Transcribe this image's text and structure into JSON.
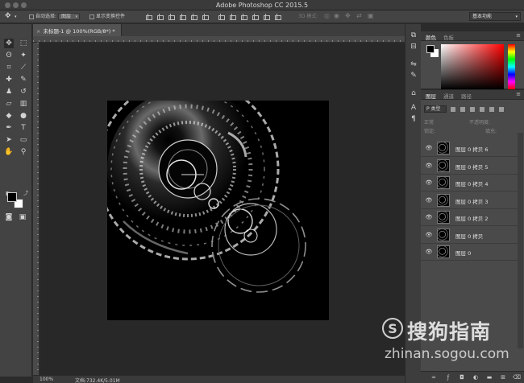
{
  "window": {
    "title": "Adobe Photoshop CC 2015.5"
  },
  "options_bar": {
    "auto_select_label": "自动选择:",
    "auto_select_value": "图层",
    "show_transform_label": "显示变换控件",
    "mode_3d_label": "3D 模式:",
    "workspace_value": "基本功能"
  },
  "document": {
    "tab_title": "未标题-1 @ 100%(RGB/8*) *",
    "zoom": "100%",
    "doc_info": "文档:732.4K/5.01M"
  },
  "toolbar": {
    "tools": [
      {
        "name": "move-tool",
        "glyph": "✥"
      },
      {
        "name": "marquee-tool",
        "glyph": "⬚"
      },
      {
        "name": "lasso-tool",
        "glyph": "ʘ"
      },
      {
        "name": "magic-wand-tool",
        "glyph": "✦"
      },
      {
        "name": "crop-tool",
        "glyph": "⌗"
      },
      {
        "name": "eyedropper-tool",
        "glyph": "⟋"
      },
      {
        "name": "healing-brush-tool",
        "glyph": "✚"
      },
      {
        "name": "brush-tool",
        "glyph": "✎"
      },
      {
        "name": "clone-stamp-tool",
        "glyph": "♟"
      },
      {
        "name": "history-brush-tool",
        "glyph": "↺"
      },
      {
        "name": "eraser-tool",
        "glyph": "▱"
      },
      {
        "name": "gradient-tool",
        "glyph": "▥"
      },
      {
        "name": "blur-tool",
        "glyph": "◆"
      },
      {
        "name": "dodge-tool",
        "glyph": "●"
      },
      {
        "name": "pen-tool",
        "glyph": "✒"
      },
      {
        "name": "type-tool",
        "glyph": "T"
      },
      {
        "name": "path-selection-tool",
        "glyph": "➤"
      },
      {
        "name": "shape-tool",
        "glyph": "▭"
      },
      {
        "name": "hand-tool",
        "glyph": "✋"
      },
      {
        "name": "zoom-tool",
        "glyph": "⚲"
      }
    ]
  },
  "panels": {
    "color": {
      "tabs": [
        "颜色",
        "色板"
      ]
    },
    "layers": {
      "tabs": [
        "图层",
        "通道",
        "路径"
      ],
      "filter_label": "P 类型",
      "blend_mode": "正常",
      "opacity_label": "不透明度:",
      "lock_label": "锁定:",
      "fill_label": "填充:",
      "items": [
        {
          "name": "图层 0 拷贝 6"
        },
        {
          "name": "图层 0 拷贝 5"
        },
        {
          "name": "图层 0 拷贝 4"
        },
        {
          "name": "图层 0 拷贝 3"
        },
        {
          "name": "图层 0 拷贝 2"
        },
        {
          "name": "图层 0 拷贝"
        },
        {
          "name": "图层 0"
        }
      ]
    }
  },
  "watermark": {
    "logo_letter": "S",
    "text": "搜狗指南",
    "url": "zhinan.sogou.com"
  }
}
